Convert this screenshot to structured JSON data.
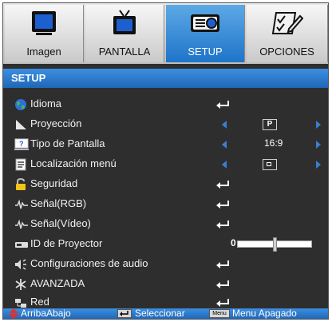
{
  "tabs": [
    {
      "label": "Imagen",
      "icon": "monitor-icon",
      "active": false
    },
    {
      "label": "PANTALLA",
      "icon": "tv-icon",
      "active": false
    },
    {
      "label": "SETUP",
      "icon": "projector-icon",
      "active": true
    },
    {
      "label": "OPCIONES",
      "icon": "checklist-icon",
      "active": false
    }
  ],
  "section_title": "SETUP",
  "rows": [
    {
      "label": "Idioma",
      "icon": "globe-icon",
      "control": "enter"
    },
    {
      "label": "Proyección",
      "icon": "projection-icon",
      "control": "select",
      "value": "P"
    },
    {
      "label": "Tipo de Pantalla",
      "icon": "screen-type-icon",
      "control": "select",
      "value": "16:9"
    },
    {
      "label": "Localización menú",
      "icon": "menu-location-icon",
      "control": "select",
      "value": ""
    },
    {
      "label": "Seguridad",
      "icon": "lock-icon",
      "control": "enter"
    },
    {
      "label": "Señal(RGB)",
      "icon": "signal-icon",
      "control": "enter"
    },
    {
      "label": "Señal(Vídeo)",
      "icon": "signal-icon",
      "control": "enter"
    },
    {
      "label": "ID de Proyector",
      "icon": "id-icon",
      "control": "slider",
      "value": "0",
      "level": 0.5
    },
    {
      "label": "Configuraciones de audio",
      "icon": "speaker-icon",
      "control": "enter"
    },
    {
      "label": "AVANZADA",
      "icon": "advanced-icon",
      "control": "enter"
    },
    {
      "label": "Red",
      "icon": "network-icon",
      "control": "enter"
    }
  ],
  "footer": {
    "nav_label": "ArribaAbajo",
    "select_label": "Seleccionar",
    "menu_key": "Menu",
    "menu_label": "Menu Apagado"
  },
  "colors": {
    "accent": "#2a7fd4",
    "background": "#2e2e2e",
    "text": "#f2f2f2"
  }
}
